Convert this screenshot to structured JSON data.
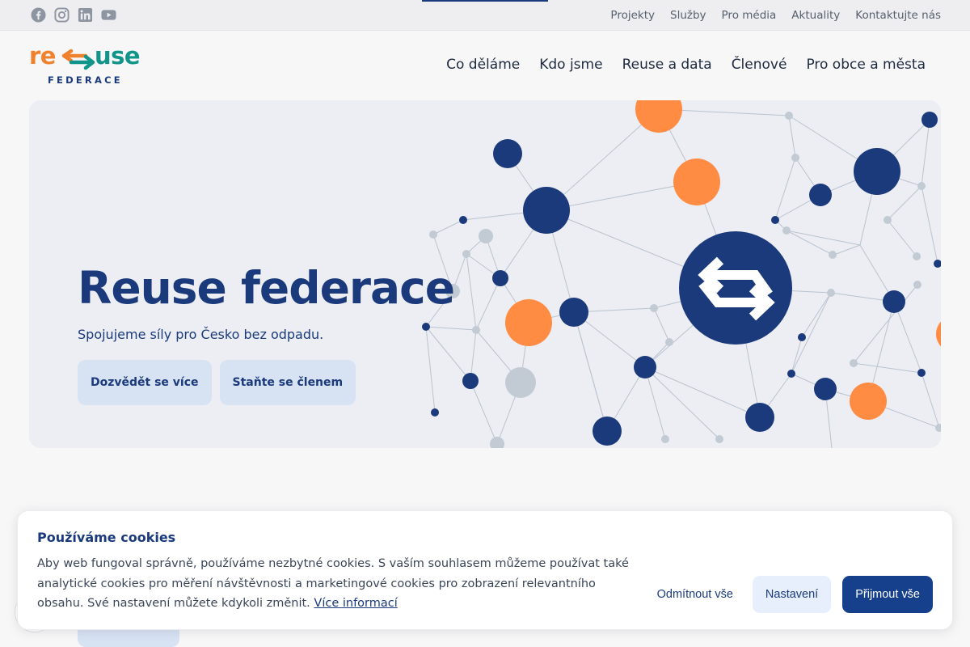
{
  "topbar": {
    "social": [
      "facebook-icon",
      "instagram-icon",
      "linkedin-icon",
      "youtube-icon"
    ],
    "links": [
      "Projekty",
      "Služby",
      "Pro média",
      "Aktuality",
      "Kontaktujte nás"
    ]
  },
  "logo": {
    "part1": "re",
    "part2": "use",
    "subtitle": "FEDERACE"
  },
  "nav": [
    "Co děláme",
    "Kdo jsme",
    "Reuse a data",
    "Členové",
    "Pro obce a města"
  ],
  "hero": {
    "title": "Reuse federace",
    "subtitle": "Spojujeme síly pro Česko bez odpadu.",
    "buttons": [
      "Dozvědět se více",
      "Staňte se členem"
    ]
  },
  "cookie": {
    "title": "Používáme cookies",
    "text": "Aby web fungoval správně, používáme nezbytné cookies. S vaším souhlasem můžeme používat také analytické cookies pro měření návštěvnosti a marketingové cookies pro zobrazení relevantního obsahu. Své nastavení můžete kdykoli změnit.",
    "link": "Více informací",
    "reject": "Odmítnout vše",
    "settings": "Nastavení",
    "accept": "Přijmout vše"
  },
  "colors": {
    "navy": "#1a3a7c",
    "orange": "#f0822e",
    "teal": "#11948a",
    "accent_button": "#163f8c"
  }
}
